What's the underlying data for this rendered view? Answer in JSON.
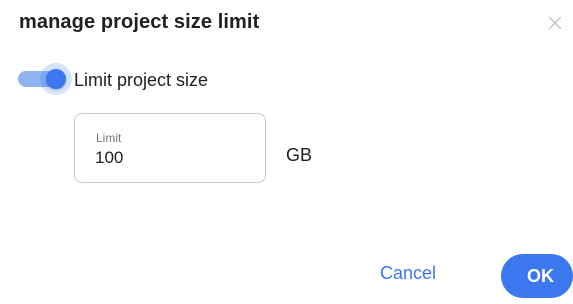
{
  "dialog": {
    "title": "manage project size limit",
    "close_icon": "close-icon"
  },
  "toggle": {
    "label": "Limit project size",
    "checked": true,
    "accent_color": "#3b78f0"
  },
  "limit_field": {
    "label": "Limit",
    "value": "100",
    "unit": "GB"
  },
  "actions": {
    "cancel_label": "Cancel",
    "ok_label": "OK"
  },
  "colors": {
    "primary": "#3b78f0",
    "text": "#202124"
  }
}
